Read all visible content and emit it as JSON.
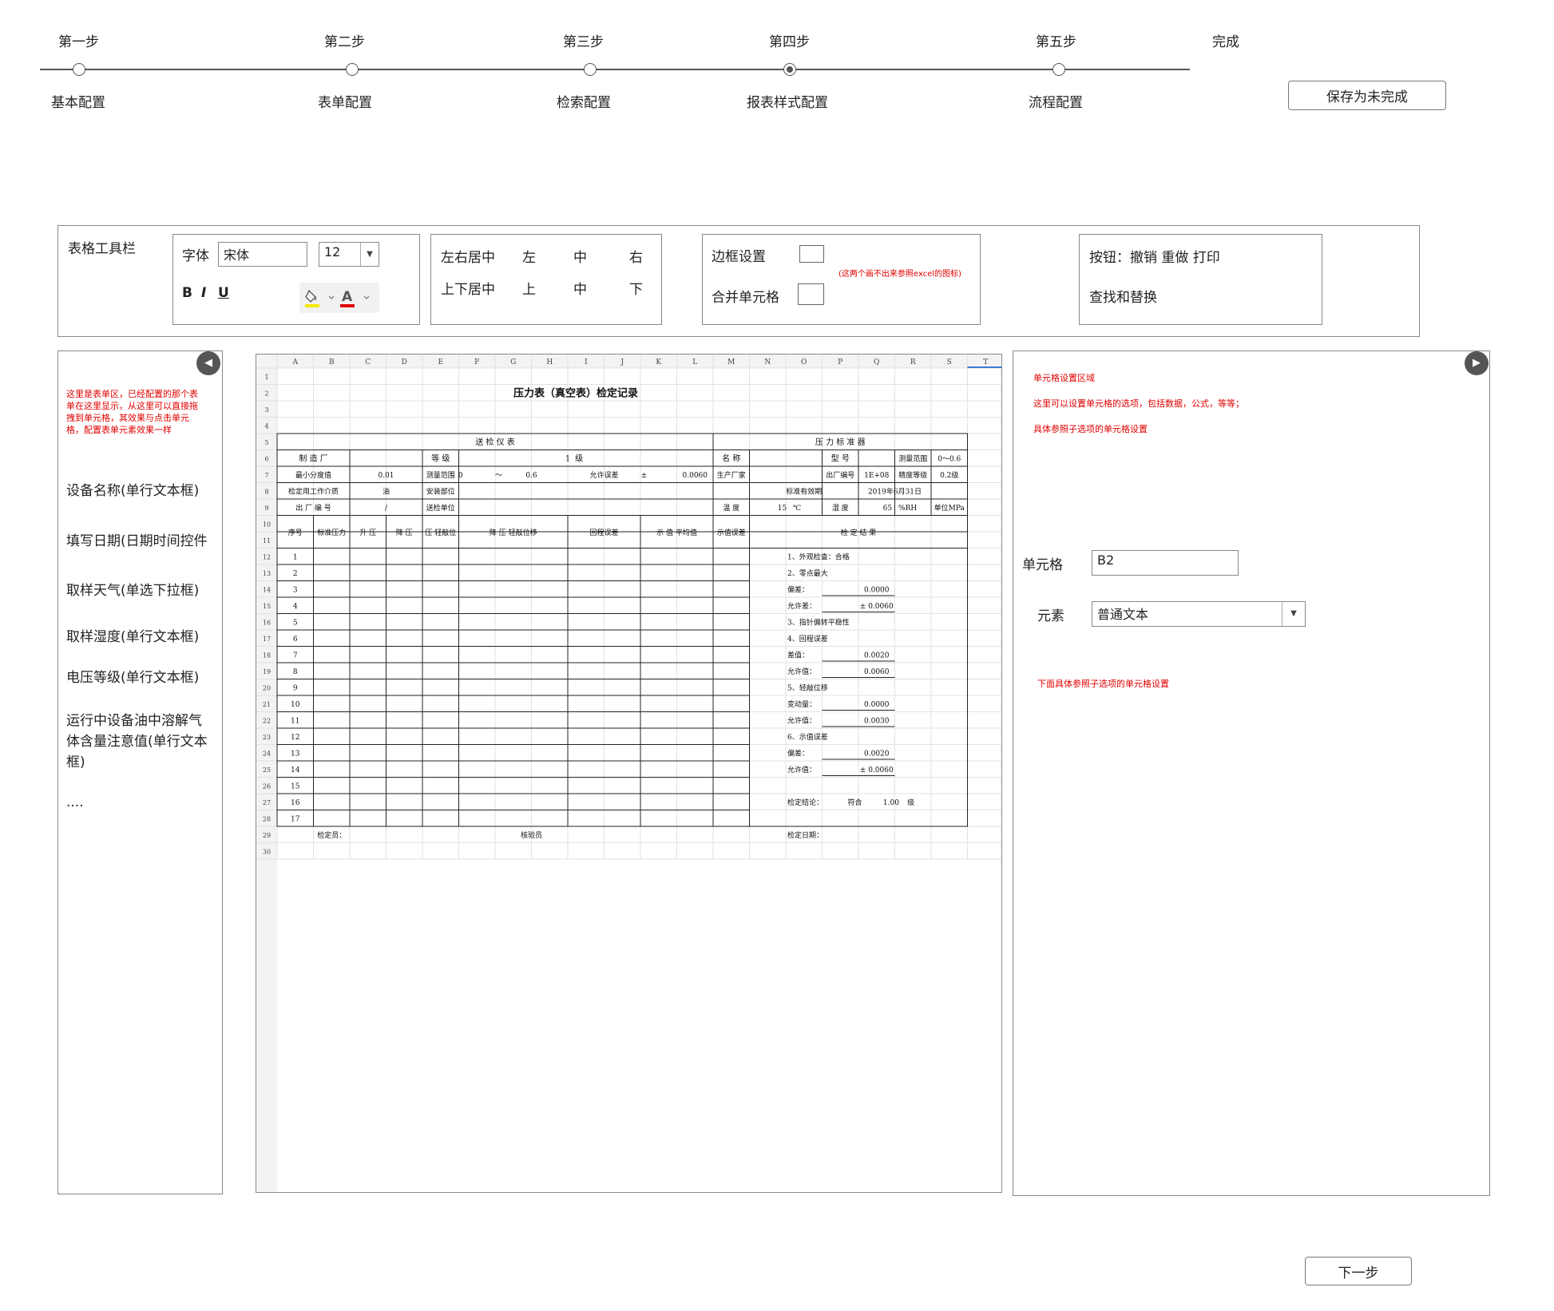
{
  "steps": [
    {
      "title": "第一步",
      "sub": "基本配置",
      "active": false
    },
    {
      "title": "第二步",
      "sub": "表单配置",
      "active": false
    },
    {
      "title": "第三步",
      "sub": "检索配置",
      "active": false
    },
    {
      "title": "第四步",
      "sub": "报表样式配置",
      "active": true
    },
    {
      "title": "第五步",
      "sub": "流程配置",
      "active": false
    }
  ],
  "steps_done_label": "完成",
  "save_label": "保存为未完成",
  "next_label": "下一步",
  "toolbar": {
    "title": "表格工具栏",
    "font_label": "字体",
    "font_value": "宋体",
    "size_value": "12",
    "bold": "B",
    "italic": "I",
    "underline": "U",
    "halign_label": "左右居中",
    "halign_left": "左",
    "halign_center": "中",
    "halign_right": "右",
    "valign_label": "上下居中",
    "valign_top": "上",
    "valign_middle": "中",
    "valign_bottom": "下",
    "border_label": "边框设置",
    "merge_label": "合并单元格",
    "border_note": "(这两个画不出来参照excel的图标)",
    "buttons_label": "按钮：撤销  重做   打印",
    "find_replace": "查找和替换"
  },
  "left_panel": {
    "note": "这里是表单区，已经配置的那个表单在这里显示，从这里可以直接拖拽到单元格，其效果与点击单元格，配置表单元素效果一样",
    "items": [
      "设备名称(单行文本框)",
      "填写日期(日期时间控件",
      "取样天气(单选下拉框)",
      "取样湿度(单行文本框)",
      "电压等级(单行文本框)",
      "运行中设备油中溶解气体含量注意值(单行文本框)",
      "...."
    ]
  },
  "right_panel": {
    "title": "单元格设置区域",
    "note1": "这里可以设置单元格的选项，包括数据，公式，等等；",
    "note2": "具体参照子选项的单元格设置",
    "cell_label": "单元格",
    "cell_value": "B2",
    "element_label": "元素",
    "element_value": "普通文本",
    "note3": "下面具体参照子选项的单元格设置"
  },
  "sheet": {
    "columns": [
      "A",
      "B",
      "C",
      "D",
      "E",
      "F",
      "G",
      "H",
      "I",
      "J",
      "K",
      "L",
      "M",
      "N",
      "O",
      "P",
      "Q",
      "R",
      "S",
      "T"
    ],
    "title": "压力表（真空表）检定记录",
    "sec_left": "送 检 仪 表",
    "sec_right": "压 力 标 准 器",
    "r6": {
      "a": "制 造 厂",
      "b": "等  级",
      "c": "1",
      "d": "级",
      "e": "名  称",
      "f": "型  号",
      "g": "测量范围",
      "h": "0～0.6"
    },
    "r7": {
      "a": "最小分度值",
      "b": "0.01",
      "c": "测量范围",
      "d": "0",
      "e": "～",
      "f": "0.6",
      "g": "允许误差",
      "h": "±",
      "i": "0.0060",
      "j": "生产厂家",
      "k": "出厂编号",
      "l": "1E+08",
      "m": "精度等级",
      "n": "0.2级"
    },
    "r8": {
      "a": "检定用工作介质",
      "b": "油",
      "c": "安装部位",
      "d": "标准有效期",
      "e": "2019年6月31日"
    },
    "r9": {
      "a": "出 厂 编 号",
      "b": "/",
      "c": "送检单位",
      "d": "温  度",
      "e": "15",
      "f": "℃",
      "g": "湿  度",
      "h": "65",
      "i": "%RH",
      "j": "单位MPa"
    },
    "headers": [
      "序号",
      "标准压力",
      "升 压",
      "降 压",
      "压  轻敲位",
      "降 压  轻敲位移",
      "回程误差",
      "示 值 平均值",
      "示值误差",
      "检 定 结 果"
    ],
    "results": [
      "1、外观检查：合格",
      "2、零点最大",
      "偏差：",
      "0.0000",
      "允许差：",
      "± 0.0060",
      "3、指针偏转平稳性",
      "4、回程误差",
      "差值：",
      "0.0020",
      "允许值：",
      "0.0060",
      "5、轻敲位移",
      "变动量：",
      "0.0000",
      "允许值：",
      "0.0030",
      "6、示值误差",
      "偏差：",
      "0.0020",
      "允许值：",
      "± 0.0060",
      "检定结论：",
      "符合",
      "1.00",
      "级"
    ],
    "footer": {
      "a": "检定员：",
      "b": "核验员",
      "c": "检定日期："
    }
  }
}
